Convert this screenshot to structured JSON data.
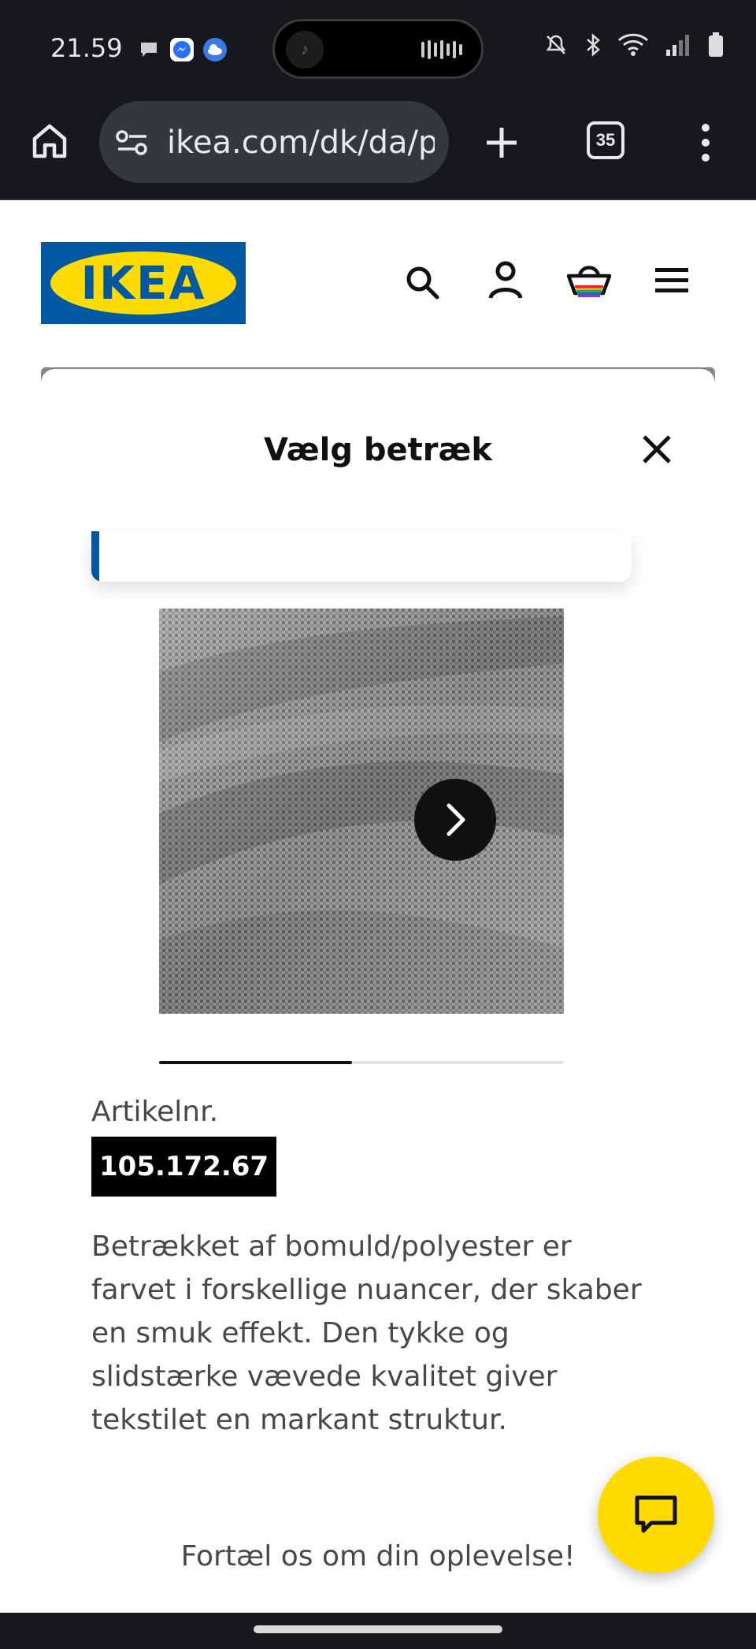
{
  "status_bar": {
    "time": "21.59",
    "notification_icons": [
      "chat-bubble-icon",
      "messenger-icon",
      "weather-icon"
    ],
    "system_icons": [
      "mute-icon",
      "bluetooth-icon",
      "wifi-icon",
      "signal-icon",
      "battery-icon"
    ]
  },
  "browser": {
    "url": "ikea.com/dk/da/pl",
    "tab_count": "35"
  },
  "header": {
    "logo_text": "IKEA",
    "icons": [
      "search-icon",
      "account-icon",
      "basket-icon",
      "menu-icon"
    ]
  },
  "modal": {
    "title": "Vælg betræk",
    "carousel_progress": 0.476,
    "article_label": "Artikelnr.",
    "article_number": "105.172.67",
    "description": "Betrækket af bomuld/polyester er farvet i forskellige nuancer, der skaber en smuk effekt. Den tykke og slidstærke vævede kvalitet giver tekstilet en markant struktur.",
    "feedback_text": "Fortæl os om din oplevelse!"
  },
  "colors": {
    "ikea_blue": "#0058a3",
    "ikea_yellow": "#ffdb00",
    "text": "#484848"
  }
}
